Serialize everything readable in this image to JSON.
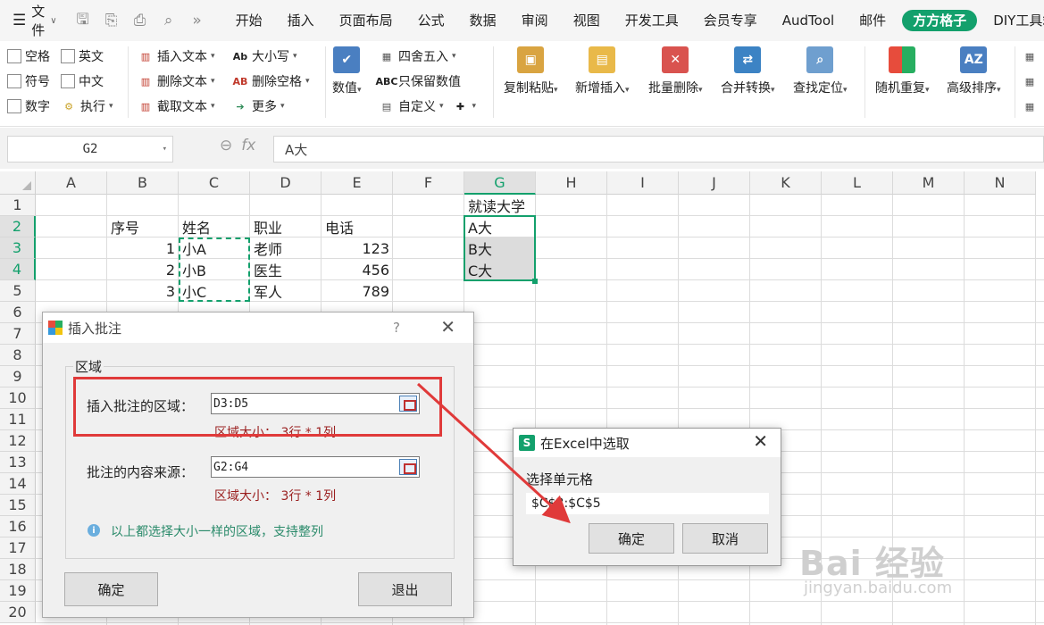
{
  "menu": {
    "file": "文件"
  },
  "tabs": [
    "开始",
    "插入",
    "页面布局",
    "公式",
    "数据",
    "审阅",
    "视图",
    "开发工具",
    "会员专享",
    "AudTool",
    "邮件",
    "方方格子",
    "DIY工具箱"
  ],
  "active_tab": "方方格子",
  "ribbon": {
    "checks": [
      "空格",
      "英文",
      "符号",
      "中文",
      "数字"
    ],
    "execute": "执行",
    "text_tools": [
      "插入文本",
      "删除文本",
      "截取文本"
    ],
    "case_tools": [
      "大小写",
      "删除空格",
      "更多"
    ],
    "value": "数值",
    "round_tools": [
      "四舍五入",
      "只保留数值",
      "自定义"
    ],
    "big_buttons": [
      "复制粘贴",
      "新增插入",
      "批量删除",
      "合并转换",
      "查找定位",
      "随机重复",
      "高级排序"
    ]
  },
  "formula_bar": {
    "name_box": "G2",
    "content": "A大",
    "fx": "fx"
  },
  "grid": {
    "columns": [
      "A",
      "B",
      "C",
      "D",
      "E",
      "F",
      "G",
      "H",
      "I",
      "J",
      "K",
      "L",
      "M",
      "N"
    ],
    "rows": [
      "1",
      "2",
      "3",
      "4",
      "5",
      "6",
      "7",
      "8",
      "9",
      "10",
      "11",
      "12",
      "13",
      "14",
      "15",
      "16",
      "17",
      "18",
      "19",
      "20"
    ],
    "cells": {
      "B2": "序号",
      "C2": "姓名",
      "D2": "职业",
      "E2": "电话",
      "B3": "1",
      "C3": "小A",
      "D3": "老师",
      "E3": "123",
      "B4": "2",
      "C4": "小B",
      "D4": "医生",
      "E4": "456",
      "B5": "3",
      "C5": "小C",
      "D5": "军人",
      "E5": "789",
      "G1": "就读大学",
      "G2": "A大",
      "G3": "B大",
      "G4": "C大"
    }
  },
  "dialog": {
    "title": "插入批注",
    "help": "?",
    "group_label": "区域",
    "range_label": "插入批注的区域：",
    "range_value": "D3:D5",
    "range_size": "区域大小： 3行 * 1列",
    "source_label": "批注的内容来源：",
    "source_value": "G2:G4",
    "source_size": "区域大小： 3行 * 1列",
    "info": "以上都选择大小一样的区域，支持整列",
    "ok": "确定",
    "exit": "退出"
  },
  "dialog2": {
    "title": "在Excel中选取",
    "label": "选择单元格",
    "value": "$C$3:$C$5",
    "ok": "确定",
    "cancel": "取消"
  },
  "watermark": {
    "main": "Bai 经验",
    "sub": "jingyan.baidu.com"
  },
  "colors": {
    "accent": "#13a06c",
    "highlight_red": "#e03a3a"
  }
}
